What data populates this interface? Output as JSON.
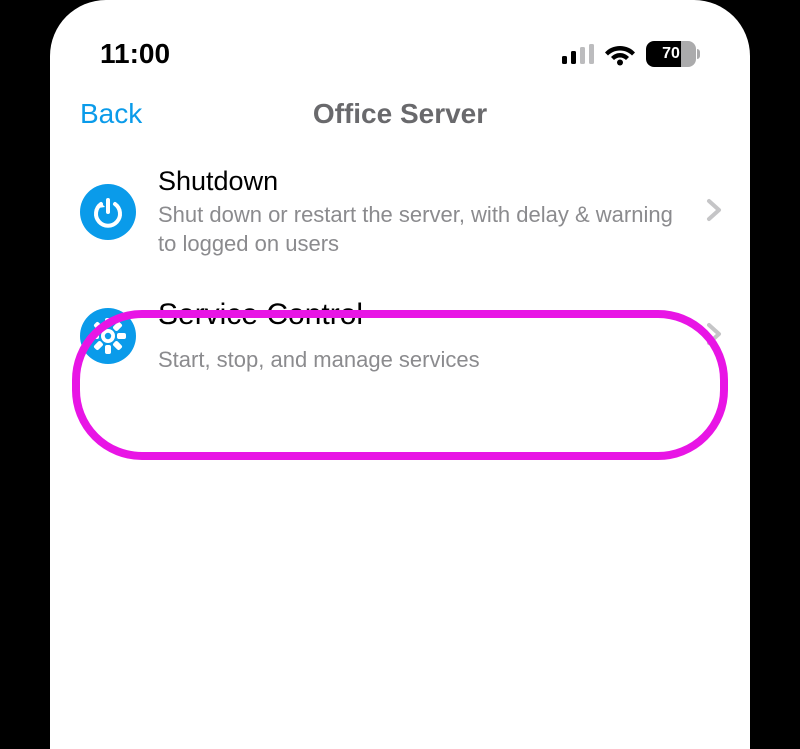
{
  "status": {
    "time": "11:00",
    "battery_percent": "70"
  },
  "nav": {
    "back_label": "Back",
    "title": "Office Server"
  },
  "items": [
    {
      "title": "Shutdown",
      "subtitle": "Shut down or restart the server, with delay & warning to logged on users"
    },
    {
      "title": "Service Control",
      "subtitle": "Start, stop, and manage services"
    }
  ]
}
